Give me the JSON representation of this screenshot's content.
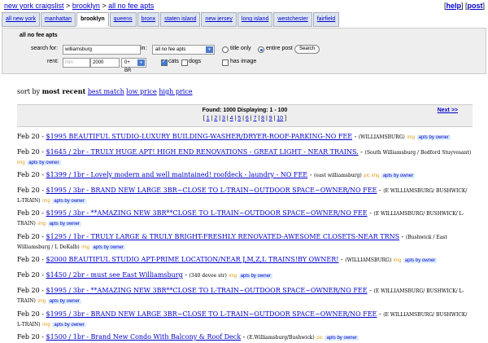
{
  "breadcrumb": {
    "site": "new york craigslist",
    "area": "brooklyn",
    "category": "all no fee apts",
    "sep": ">"
  },
  "topright": {
    "help": "help",
    "post": "post",
    "open": "[",
    "mid": "] [",
    "close": "]"
  },
  "tabs": [
    "all new york",
    "manhattan",
    "brooklyn",
    "queens",
    "bronx",
    "staten island",
    "new jersey",
    "long island",
    "westchester",
    "fairfield"
  ],
  "active_tab": "brooklyn",
  "search": {
    "legend": "all no fee apts",
    "search_for_label": "search for:",
    "query": "williamsburg",
    "in_label": "in:",
    "category": "all no fee apts",
    "title_only": "title only",
    "entire_post": "entire post",
    "search_button": "Search",
    "rent_label": "rent:",
    "min_placeholder": "min",
    "max_value": "2000",
    "bedrooms": "0+ BR",
    "cats": "cats",
    "dogs": "dogs",
    "has_image": "has image"
  },
  "sort": {
    "prefix": "sort by",
    "current": "most recent",
    "best_match": "best match",
    "low_price": "low price",
    "high_price": "high price"
  },
  "results": {
    "found": "Found: 1000 Displaying: 1 - 100",
    "pages": [
      "1",
      "2",
      "3",
      "4",
      "5",
      "6",
      "7",
      "8",
      "9",
      "10"
    ],
    "next": "Next >>"
  },
  "listings": [
    {
      "date": "Feb 20",
      "title": "$1995 BEAUTIFUL STUDIO-LUXURY BUILDING-WASHER/DRYER-ROOF-PARKING-NO FEE",
      "loc": "(WILLIAMSBURG)",
      "tag": "img",
      "cat": "apts by owner"
    },
    {
      "date": "Feb 20",
      "title": "$1645 / 2br - TRULY HUGE APT! HIGH END RENOVATIONS - GREAT LIGHT - NEAR TRAINS.",
      "loc": "(South Williamsburg / Bedford Stuyvesant)",
      "tag": "img",
      "cat": "apts by owner"
    },
    {
      "date": "Feb 20",
      "title": "$1399 / 1br - Lovely modern and well maintained! roofdeck - laundry - NO FEE",
      "loc": "(east williamsburg)",
      "tag": "pic img",
      "cat": "apts by owner"
    },
    {
      "date": "Feb 20",
      "title": "$1995 / 3br - BRAND NEW LARGE 3BR~CLOSE TO L-TRAIN~OUTDOOR SPACE~OWNER/NO FEE",
      "loc": "(E WILLIAMSBURG/ BUSHWICK/ L-TRAIN)",
      "tag": "img",
      "cat": "apts by owner"
    },
    {
      "date": "Feb 20",
      "title": "$1995 / 3br - **AMAZING NEW 3BR**CLOSE TO L-TRAIN~OUTDOOR SPACE~OWNER/NO FEE",
      "loc": "(E WILLIAMSBURG/ BUSHWICK/ L-TRAIN)",
      "tag": "img",
      "cat": "apts by owner"
    },
    {
      "date": "Feb 20",
      "title": "$1295 / 1br - TRULY LARGE & TRULY BRIGHT-FRESHLY RENOVATED-AWESOME CLOSETS-NEAR TRNS",
      "loc": "(Bushwick / East Williamsburg / L DeKalb)",
      "tag": "img",
      "cat": "apts by owner"
    },
    {
      "date": "Feb 20",
      "title": "$2000 BEAUTIFUL STUDIO APT-PRIME LOCATION/NEAR J,M,Z,L TRAINS!BY OWNER!",
      "loc": "(WILLIAMSBURG)",
      "tag": "img",
      "cat": "apts by owner"
    },
    {
      "date": "Feb 20",
      "title": "$1450 / 2br - must see East Williamsburg",
      "loc": "(340 devoe str)",
      "tag": "img",
      "cat": "apts by owner"
    },
    {
      "date": "Feb 20",
      "title": "$1995 / 3br - **AMAZING NEW 3BR**CLOSE TO L-TRAIN~OUTDOOR SPACE~OWNER/NO FEE",
      "loc": "(E WILLIAMSBURG/ BUSHWICK/ L-TRAIN)",
      "tag": "img",
      "cat": "apts by owner"
    },
    {
      "date": "Feb 20",
      "title": "$1995 / 3br - BRAND NEW LARGE 3BR~CLOSE TO L-TRAIN~OUTDOOR SPACE~OWNER/NO FEE",
      "loc": "(E WILLIAMSBURG/ BUSHWICK/ L-TRAIN)",
      "tag": "img",
      "cat": "apts by owner"
    },
    {
      "date": "Feb 20",
      "title": "$1500 / 1br - Brand New Condo With Balcony & Roof Deck",
      "loc": "(E.Williamsburg/Bushwick)",
      "tag": "pic",
      "cat": "apts by owner"
    }
  ]
}
